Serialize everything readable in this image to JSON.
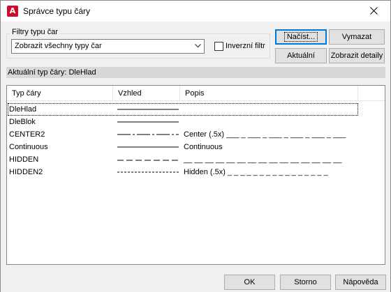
{
  "window": {
    "title": "Správce typu čáry",
    "app_icon_letter": "A",
    "app_icon_color": "#c8102e"
  },
  "filters": {
    "group_label": "Filtry typu čar",
    "combo_value": "Zobrazit všechny typy čar",
    "inverse_filter_label": "Inverzní filtr",
    "inverse_filter_checked": false
  },
  "buttons": {
    "load": "Načíst...",
    "delete": "Vymazat",
    "current": "Aktuální",
    "show_details": "Zobrazit detaily",
    "ok": "OK",
    "cancel": "Storno",
    "help": "Nápověda"
  },
  "current_linetype": {
    "label": "Aktuální typ čáry:",
    "value": "DleHlad"
  },
  "table": {
    "columns": [
      "Typ čáry",
      "Vzhled",
      "Popis"
    ],
    "rows": [
      {
        "name": "DleHlad",
        "appearance": "continuous",
        "description": "",
        "selected": true
      },
      {
        "name": "DleBlok",
        "appearance": "continuous",
        "description": "",
        "selected": false
      },
      {
        "name": "CENTER2",
        "appearance": "center",
        "description": "Center (.5x) ___ _ ___ _ ___ _ ___ _ ___ _ ___",
        "selected": false
      },
      {
        "name": "Continuous",
        "appearance": "continuous",
        "description": "Continuous",
        "selected": false
      },
      {
        "name": "HIDDEN",
        "appearance": "hidden",
        "description": "__ __ __ __ __ __ __ __ __ __ __ __ __ __ __",
        "selected": false
      },
      {
        "name": "HIDDEN2",
        "appearance": "hidden2",
        "description": "Hidden (.5x) _ _ _ _ _ _ _ _ _ _ _ _ _ _ _ _",
        "selected": false
      }
    ]
  },
  "colors": {
    "default_button_border": "#0078d7",
    "list_background": "#ffffff",
    "current_bar": "#d8d8d8"
  }
}
